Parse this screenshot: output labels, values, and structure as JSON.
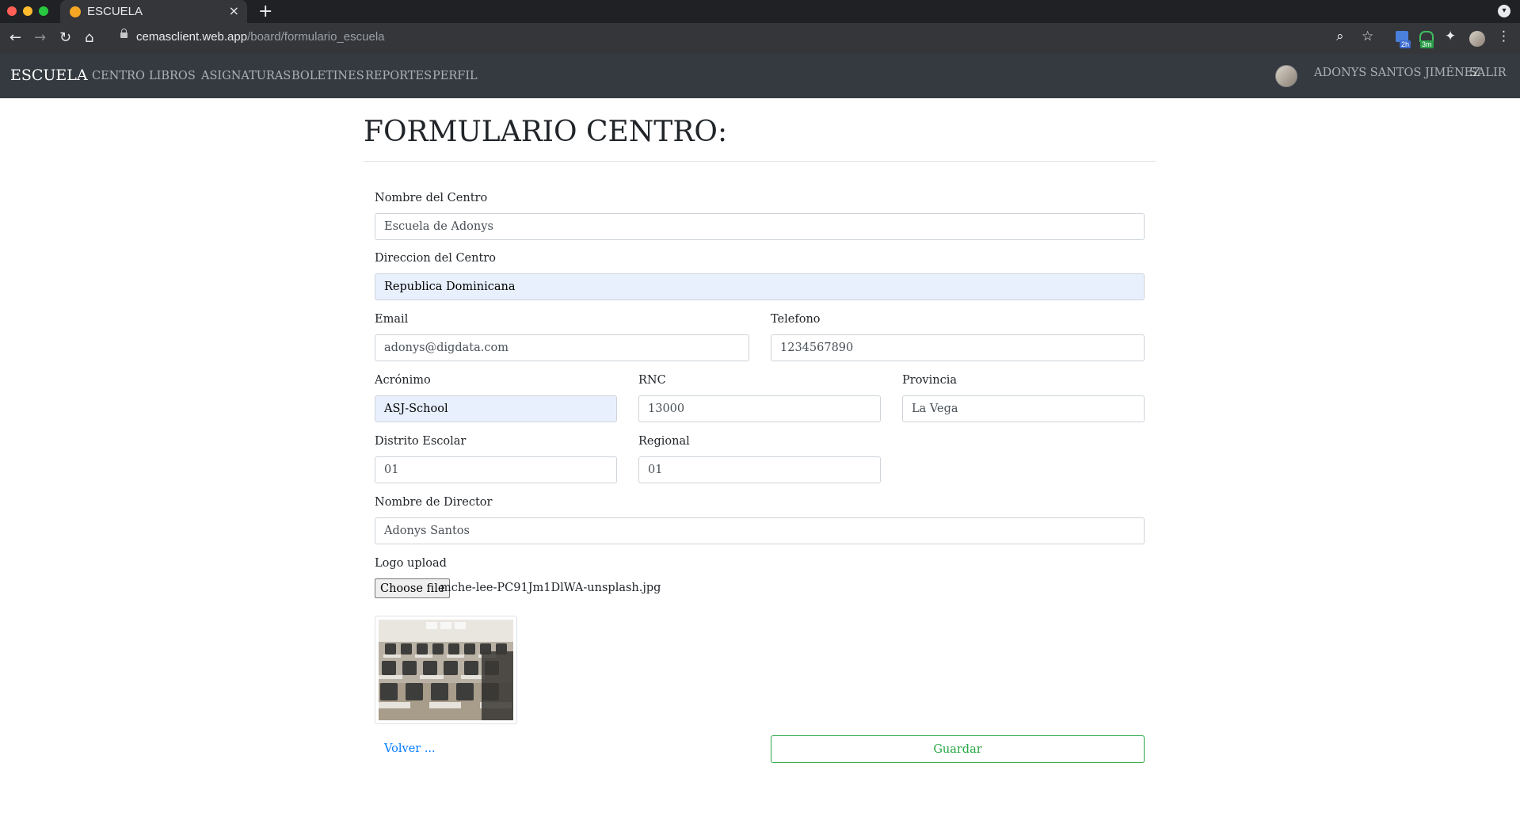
{
  "browser": {
    "tab_title": "ESCUELA",
    "tab_close": "×",
    "new_tab": "+",
    "url_host": "cemasclient.web.app",
    "url_path": "/board/formulario_escuela",
    "ext_badge_1": "2h",
    "ext_badge_2": "3m"
  },
  "navbar": {
    "brand": "ESCUELA",
    "links": [
      "CENTRO",
      "LIBROS",
      "ASIGNATURAS",
      "BOLETINES",
      "REPORTES",
      "PERFIL"
    ],
    "user_name": "ADONYS SANTOS JIMÉNEZ",
    "logout": "SALIR"
  },
  "form": {
    "title": "FORMULARIO CENTRO:",
    "nombre_centro": {
      "label": "Nombre del Centro",
      "value": "Escuela de Adonys"
    },
    "direccion": {
      "label": "Direccion del Centro",
      "value": "Republica Dominicana"
    },
    "email": {
      "label": "Email",
      "value": "adonys@digdata.com"
    },
    "telefono": {
      "label": "Telefono",
      "value": "1234567890"
    },
    "acronimo": {
      "label": "Acrónimo",
      "value": "ASJ-School"
    },
    "rnc": {
      "label": "RNC",
      "value": "13000"
    },
    "provincia": {
      "label": "Provincia",
      "value": "La Vega"
    },
    "distrito": {
      "label": "Distrito Escolar",
      "value": "01"
    },
    "regional": {
      "label": "Regional",
      "value": "01"
    },
    "director": {
      "label": "Nombre de Director",
      "value": "Adonys Santos"
    },
    "logo": {
      "label": "Logo upload",
      "button": "Choose file",
      "filename": "mche-lee-PC91Jm1DlWA-unsplash.jpg"
    },
    "back_link": "Volver ...",
    "save_button": "Guardar"
  },
  "colors": {
    "navbar_bg": "#343a40",
    "link_blue": "#007bff",
    "success_green": "#28a745",
    "autofill_bg": "#e8f0fe"
  }
}
